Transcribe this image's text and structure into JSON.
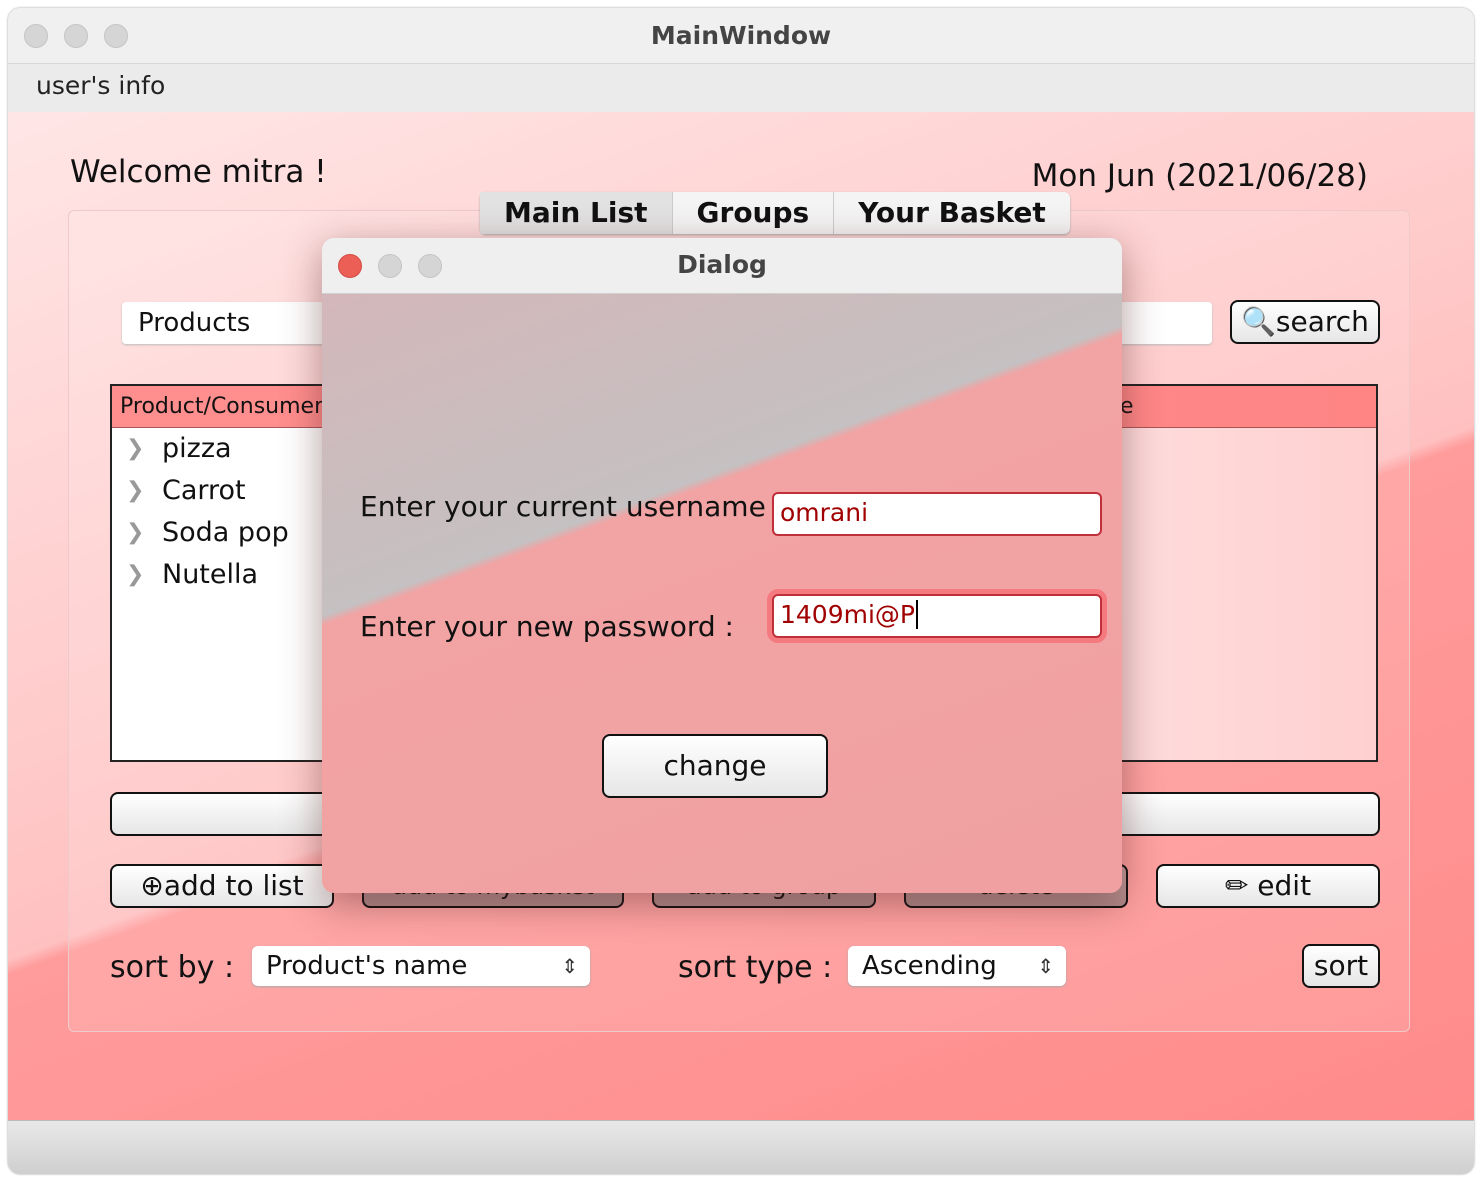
{
  "window": {
    "title": "MainWindow",
    "menu": "user's info"
  },
  "header": {
    "welcome": "Welcome mitra !",
    "date": "Mon Jun (2021/06/28)"
  },
  "tabs": [
    {
      "label": "Main List"
    },
    {
      "label": "Groups"
    },
    {
      "label": "Your Basket"
    }
  ],
  "search": {
    "category": "Products",
    "button": "search"
  },
  "table": {
    "header": "Product/Consumer",
    "header_tail": "e",
    "rows": [
      "pizza",
      "Carrot",
      "Soda pop",
      "Nutella"
    ]
  },
  "actions": {
    "add_to_list": "add to list",
    "add_to_basket": "add to mybasket",
    "add_to_group": "add to group",
    "delete": "delete",
    "edit": "edit"
  },
  "sort": {
    "label": "sort by :",
    "value": "Product's name",
    "type_label": "sort type :",
    "type_value": "Ascending",
    "button": "sort"
  },
  "dialog": {
    "title": "Dialog",
    "username_label": "Enter your current username :",
    "username_value": "omrani",
    "password_label": "Enter your new password :",
    "password_value": "1409mi@P",
    "button": "change"
  },
  "colors": {
    "accent": "#ff8a8a",
    "input_text": "#a00000",
    "close": "#ec5f57"
  }
}
